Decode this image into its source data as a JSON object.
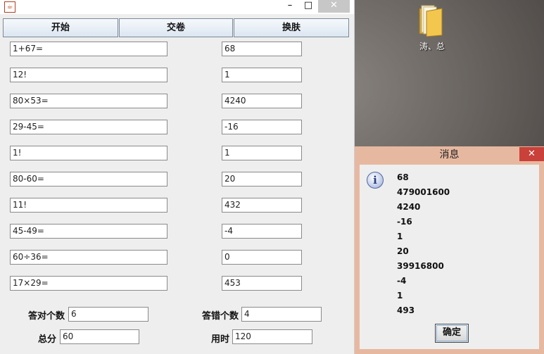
{
  "window": {
    "minimize_glyph": "–",
    "maximize_glyph": "□",
    "close_glyph": "✕"
  },
  "toolbar": {
    "start_label": "开始",
    "submit_label": "交卷",
    "skin_label": "换肤"
  },
  "questions": [
    {
      "q": "1+67=",
      "a": "68"
    },
    {
      "q": "12!",
      "a": "1"
    },
    {
      "q": "80×53=",
      "a": "4240"
    },
    {
      "q": "29-45=",
      "a": "-16"
    },
    {
      "q": "1!",
      "a": "1"
    },
    {
      "q": "80-60=",
      "a": "20"
    },
    {
      "q": "11!",
      "a": "432"
    },
    {
      "q": "45-49=",
      "a": "-4"
    },
    {
      "q": "60÷36=",
      "a": "0"
    },
    {
      "q": "17×29=",
      "a": "453"
    }
  ],
  "stats": {
    "correct_label": "答对个数",
    "correct_value": "6",
    "wrong_label": "答错个数",
    "wrong_value": "4",
    "score_label": "总分",
    "score_value": "60",
    "time_label": "用时",
    "time_value": "120"
  },
  "desktop": {
    "folder_label": "涛、总"
  },
  "dialog": {
    "title": "消息",
    "close_glyph": "✕",
    "icon_glyph": "i",
    "lines": [
      "68",
      "479001600",
      "4240",
      "-16",
      "1",
      "20",
      "39916800",
      "-4",
      "1",
      "493"
    ],
    "ok_label": "确定"
  }
}
